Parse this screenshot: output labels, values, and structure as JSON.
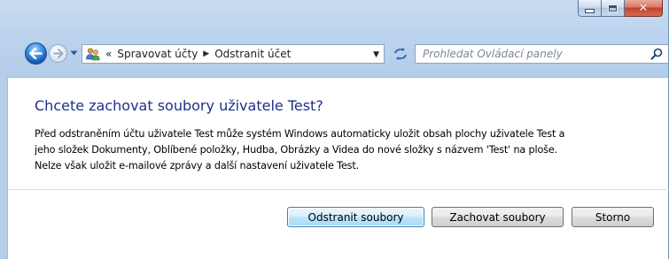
{
  "window": {
    "caption_buttons": {
      "minimize_icon": "minimize-icon",
      "maximize_icon": "maximize-icon",
      "close_icon": "close-icon",
      "close_glyph": "✕"
    }
  },
  "nav": {
    "back_icon": "back-arrow-icon",
    "forward_icon": "forward-arrow-icon",
    "history_icon": "chevron-down-icon",
    "address": {
      "icon": "user-accounts-icon",
      "overflow": "«",
      "breadcrumbs": [
        {
          "label": "Spravovat účty"
        },
        {
          "label": "Odstranit účet"
        }
      ],
      "separator": "▶",
      "dropdown": "▼"
    },
    "refresh_icon": "refresh-icon",
    "search": {
      "placeholder": "Prohledat Ovládací panely",
      "icon": "search-icon"
    }
  },
  "content": {
    "title": "Chcete zachovat soubory uživatele Test?",
    "description_lines": [
      "Před odstraněním účtu uživatele Test může systém Windows automaticky uložit obsah plochy uživatele Test a",
      "jeho složek Dokumenty, Oblíbené položky, Hudba, Obrázky a Videa do nové složky s názvem 'Test' na ploše.",
      "Nelze však uložit e-mailové zprávy a další nastavení uživatele Test."
    ],
    "buttons": {
      "delete_files": "Odstranit soubory",
      "keep_files": "Zachovat soubory",
      "cancel": "Storno"
    }
  },
  "colors": {
    "title": "#1e3287",
    "chrome": "#bcd3ee",
    "close_button": "#c2402a"
  }
}
